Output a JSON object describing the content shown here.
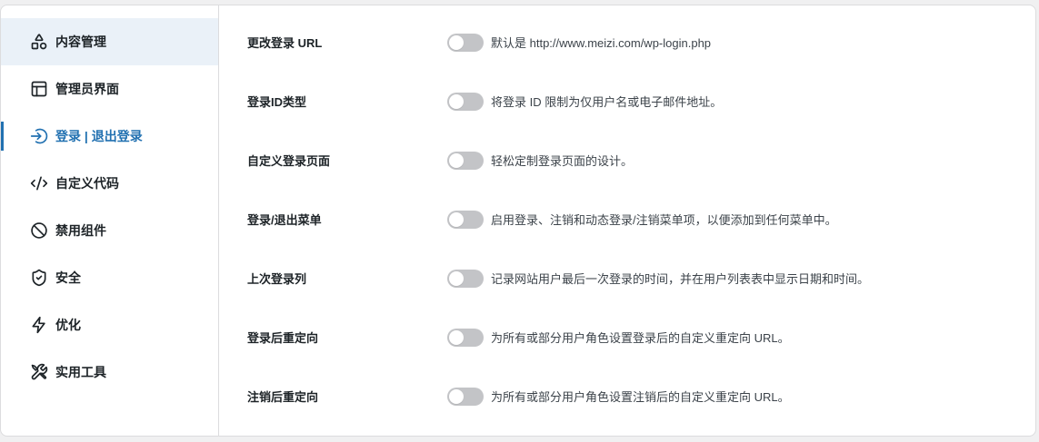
{
  "colors": {
    "accent": "#2271b1",
    "highlight_bg": "#eaf1f8",
    "page_bg": "#f0f0f1",
    "card_bg": "#ffffff",
    "border": "#dcdcde",
    "text": "#1d2327",
    "muted_text": "#3c434a",
    "toggle_off": "#c3c4c7",
    "toggle_on": "#2271b1",
    "toggle_knob": "#ffffff"
  },
  "sidebar": {
    "items": [
      {
        "label": "内容管理",
        "icon": "shapes-icon",
        "active": false,
        "highlighted": true
      },
      {
        "label": "管理员界面",
        "icon": "layout-panel-icon",
        "active": false,
        "highlighted": false
      },
      {
        "label": "登录 | 退出登录",
        "icon": "log-in-icon",
        "active": true,
        "highlighted": false
      },
      {
        "label": "自定义代码",
        "icon": "code-icon",
        "active": false,
        "highlighted": false
      },
      {
        "label": "禁用组件",
        "icon": "ban-icon",
        "active": false,
        "highlighted": false
      },
      {
        "label": "安全",
        "icon": "shield-check-icon",
        "active": false,
        "highlighted": false
      },
      {
        "label": "优化",
        "icon": "zap-icon",
        "active": false,
        "highlighted": false
      },
      {
        "label": "实用工具",
        "icon": "tools-icon",
        "active": false,
        "highlighted": false
      }
    ]
  },
  "settings": {
    "rows": [
      {
        "label": "更改登录 URL",
        "description": "默认是 http://www.meizi.com/wp-login.php",
        "enabled": false
      },
      {
        "label": "登录ID类型",
        "description": "将登录 ID 限制为仅用户名或电子邮件地址。",
        "enabled": false
      },
      {
        "label": "自定义登录页面",
        "description": "轻松定制登录页面的设计。",
        "enabled": false
      },
      {
        "label": "登录/退出菜单",
        "description": "启用登录、注销和动态登录/注销菜单项，以便添加到任何菜单中。",
        "enabled": false
      },
      {
        "label": "上次登录列",
        "description": "记录网站用户最后一次登录的时间，并在用户列表表中显示日期和时间。",
        "enabled": false
      },
      {
        "label": "登录后重定向",
        "description": "为所有或部分用户角色设置登录后的自定义重定向 URL。",
        "enabled": false
      },
      {
        "label": "注销后重定向",
        "description": "为所有或部分用户角色设置注销后的自定义重定向 URL。",
        "enabled": false
      }
    ]
  }
}
